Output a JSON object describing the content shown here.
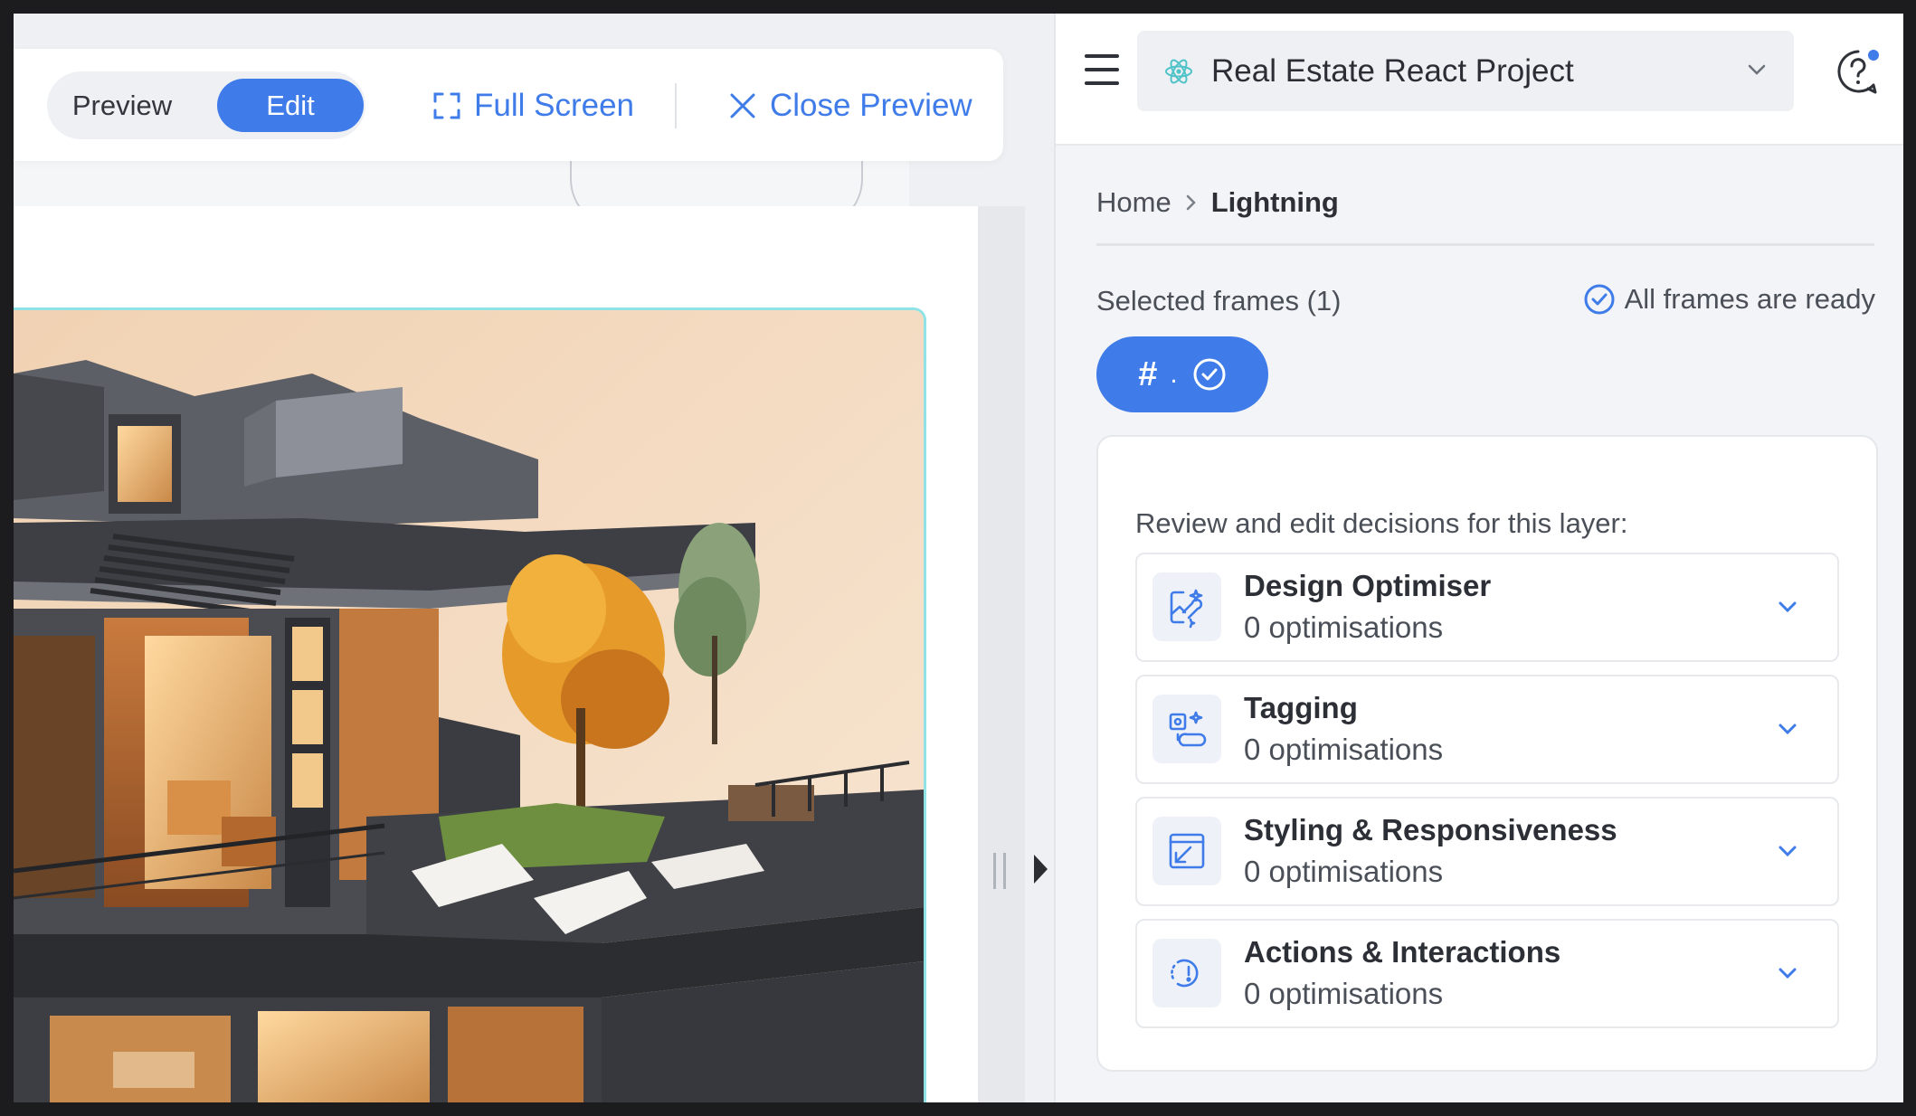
{
  "preview_toolbar": {
    "mode_preview": "Preview",
    "mode_edit": "Edit",
    "full_screen": "Full Screen",
    "close_preview": "Close Preview"
  },
  "header": {
    "project_name": "Real Estate React Project"
  },
  "breadcrumb": {
    "home": "Home",
    "current": "Lightning"
  },
  "frames": {
    "selected_label": "Selected frames (1)",
    "ready_label": "All frames are ready",
    "chip_hash": "#",
    "chip_dot": "."
  },
  "decisions": {
    "intro": "Review and edit decisions for this layer:",
    "items": [
      {
        "title": "Design Optimiser",
        "subtitle": "0 optimisations",
        "icon": "design-optimiser-icon"
      },
      {
        "title": "Tagging",
        "subtitle": "0 optimisations",
        "icon": "tagging-icon"
      },
      {
        "title": "Styling & Responsiveness",
        "subtitle": "0 optimisations",
        "icon": "styling-icon"
      },
      {
        "title": "Actions & Interactions",
        "subtitle": "0 optimisations",
        "icon": "actions-icon"
      }
    ]
  },
  "colors": {
    "accent": "#3f7ce9",
    "hero_border": "#8fe3e6",
    "react_logo": "#4fc3c8"
  }
}
